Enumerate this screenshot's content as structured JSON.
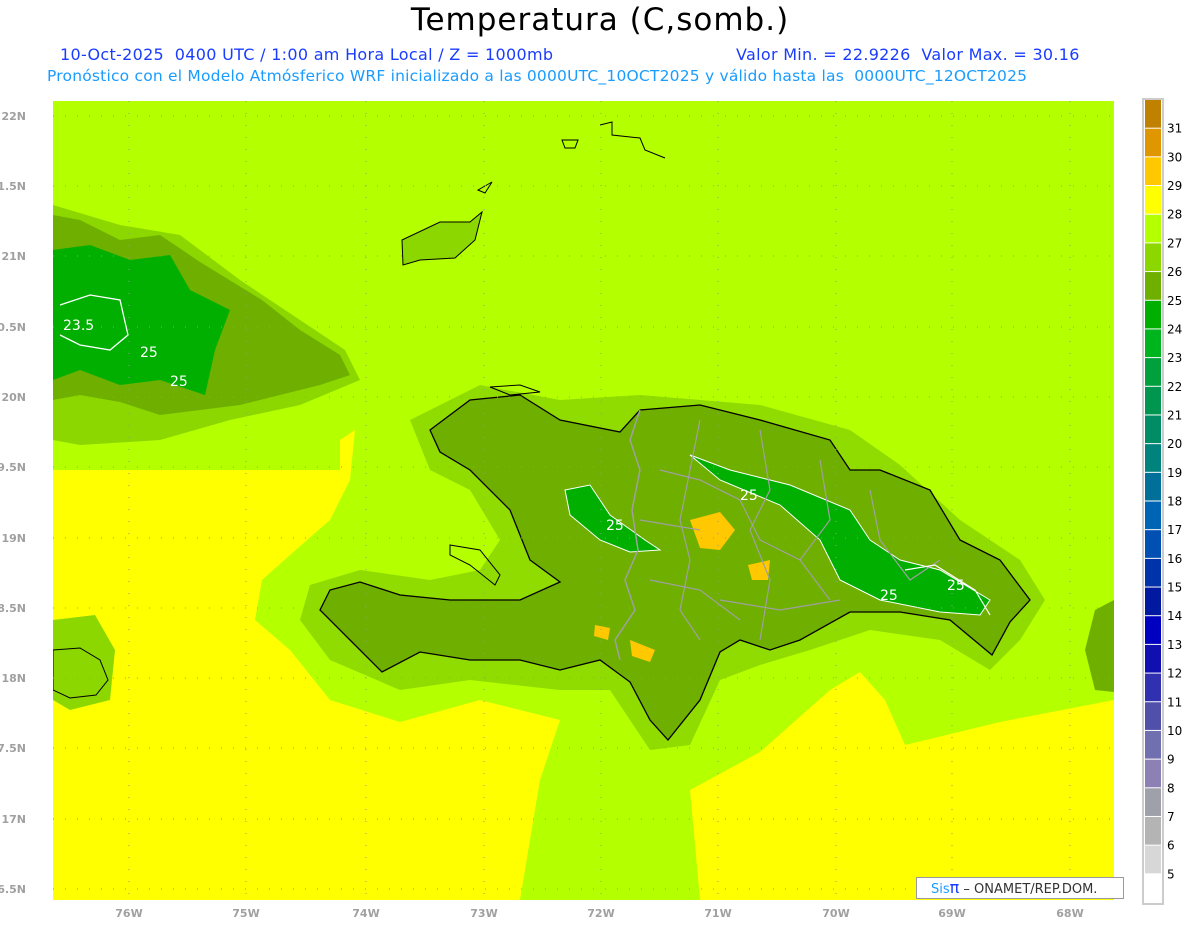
{
  "header": {
    "title": "Temperatura (C,somb.)",
    "subtitle_left": "10-Oct-2025  0400 UTC / 1:00 am Hora Local / Z = 1000mb",
    "subtitle_right": "Valor Min. = 22.9226  Valor Max. = 30.16",
    "subtitle_2": "Pronóstico con el Modelo Atmósferico WRF inicializado a las 0000UTC_10OCT2025 y válido hasta las  0000UTC_12OCT2025"
  },
  "map": {
    "lon_labels": [
      "76W",
      "75W",
      "74W",
      "73W",
      "72W",
      "71W",
      "70W",
      "69W",
      "68W"
    ],
    "lat_labels": [
      "22N",
      "1.5N",
      "21N",
      "0.5N",
      "20N",
      "9.5N",
      "19N",
      "8.5N",
      "18N",
      "7.5N",
      "17N",
      "6.5N"
    ],
    "contour_labels": [
      "23.5",
      "25",
      "25",
      "25",
      "25",
      "25",
      "25"
    ],
    "colors": {
      "ocean_main": "#b4ff00",
      "yellow": "#ffff00",
      "coast": "#000000",
      "borders": "#a0a0a0"
    }
  },
  "colorbar": {
    "labels": [
      "31",
      "30",
      "29",
      "28",
      "27",
      "26",
      "25",
      "24",
      "23",
      "22",
      "21",
      "20",
      "19",
      "18",
      "17",
      "16",
      "15",
      "14",
      "13",
      "12",
      "11",
      "10",
      "9",
      "8",
      "7",
      "6",
      "5"
    ],
    "colors": [
      "#c08000",
      "#e09600",
      "#ffc800",
      "#ffff00",
      "#b4ff00",
      "#8cd700",
      "#6eaf00",
      "#00af00",
      "#00b41e",
      "#00a03c",
      "#009650",
      "#008c64",
      "#00827d",
      "#00709a",
      "#0064b4",
      "#0050b4",
      "#0032aa",
      "#0019a0",
      "#0000c0",
      "#1010b0",
      "#3030b0",
      "#5050aa",
      "#7070b0",
      "#8c80b4",
      "#a0a0aa",
      "#b4b4b4",
      "#d7d7d7",
      "#ffffff"
    ]
  },
  "credit": {
    "sis": "Sis",
    "pi": "π",
    "org": " – ONAMET/REP.DOM."
  }
}
